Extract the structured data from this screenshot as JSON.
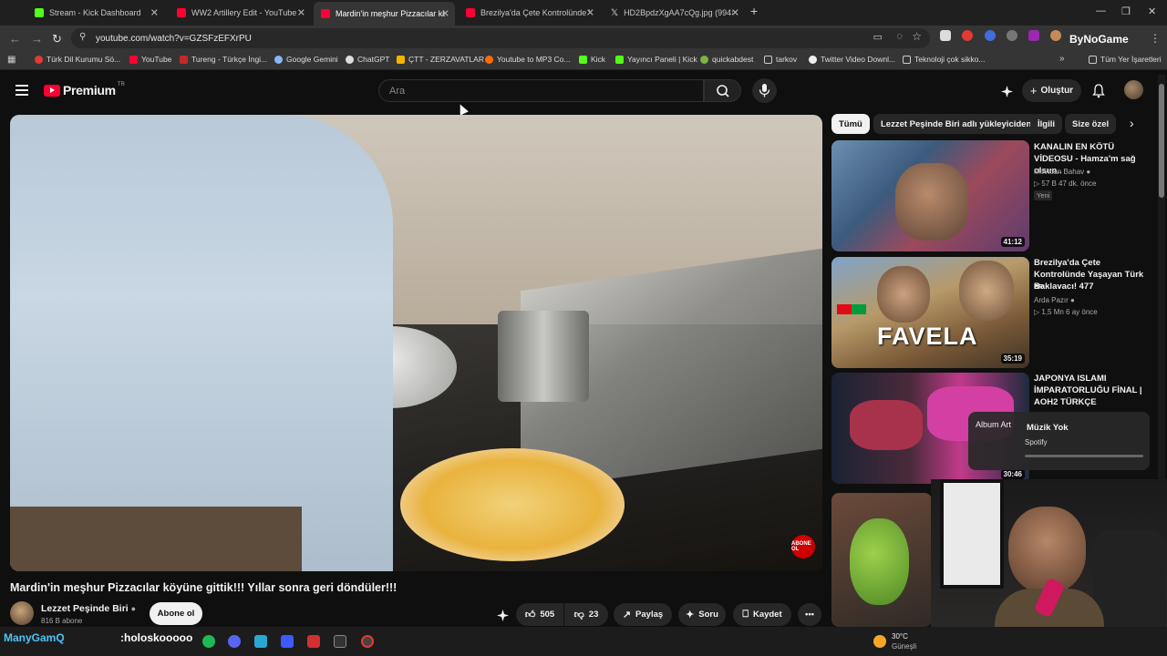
{
  "tabs": [
    {
      "title": "Stream - Kick Dashboard",
      "color": "#53fc18"
    },
    {
      "title": "WW2 Artillery Edit - YouTube",
      "color": "#ff0033"
    },
    {
      "title": "Mardin'in meşhur Pizzacılar köy",
      "color": "#ff0033"
    },
    {
      "title": "Brezilya'da Çete Kontrolünde Ya",
      "color": "#ff0033"
    },
    {
      "title": "HD2BpdzXgAA7cQg.jpg (994×",
      "color": "#cccccc"
    }
  ],
  "address": {
    "url": "youtube.com/watch?v=GZSFzEFXrPU",
    "extension_label": "ByNoGame"
  },
  "bookmarks": [
    "Türk Dil Kurumu Sö...",
    "YouTube",
    "Tureng - Türkçe İngi...",
    "Google Gemini",
    "ChatGPT",
    "ÇTT - ZERZAVATLAR",
    "Youtube to MP3 Co...",
    "Kick",
    "Yayıncı Paneli | Kick",
    "quickabdest",
    "tarkov",
    "Twitter Video Downl...",
    "Teknoloji çok sikko..."
  ],
  "bookmarks_all": "Tüm Yer İşaretleri",
  "header": {
    "logo_text": "Premium",
    "logo_region": "TR",
    "search_placeholder": "Ara",
    "create_label": "Oluştur"
  },
  "video": {
    "title": "Mardin'in meşhur Pizzacılar köyüne gittik!!! Yıllar sonra geri döndüler!!!",
    "channel": "Lezzet Peşinde Biri",
    "subscribers": "816 B abone",
    "subscribe_label": "Abone ol",
    "badge": "ABONE OL",
    "likes": "505",
    "dislikes": "23",
    "share_label": "Paylaş",
    "ask_label": "Soru",
    "save_label": "Kaydet"
  },
  "chips": [
    "Tümü",
    "Lezzet Peşinde Biri adlı yükleyiciden",
    "İlgili",
    "Size özel"
  ],
  "recommendations": [
    {
      "title": "KANALIN EN KÖTÜ VİDEOSU - Hamza'm sağ olsun..",
      "channel": "Mevtcan Bahav",
      "meta": "▷ 57 B   47 dk. önce",
      "badge": "Yeni",
      "duration": "41:12"
    },
    {
      "title": "Brezilya'da Çete Kontrolünde Yaşayan Türk Baklavacı!  477",
      "channel_tag": "BR",
      "channel": "Arda Pazır",
      "meta": "▷ 1,5 Mn   6 ay önce",
      "duration": "35:19",
      "overlay_text": "FAVELA"
    },
    {
      "title": "JAPONYA ISLAMI İMPARATORLUĞU FİNAL | AOH2 TÜRKÇE",
      "channel": "",
      "meta": "",
      "duration": "30:46"
    }
  ],
  "spotify": {
    "art_label": "Album Art",
    "title": "Müzik Yok",
    "subtitle": "Spotify"
  },
  "taskbar": {
    "chat_user": "ManyGamQ",
    "chat_message": ":holoskooooo",
    "temperature": "30°C",
    "weather": "Güneşli"
  }
}
